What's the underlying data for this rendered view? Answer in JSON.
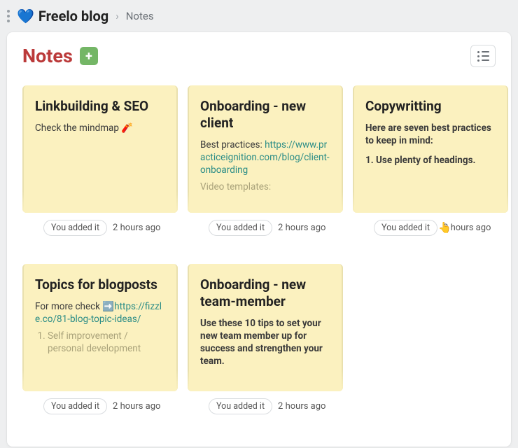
{
  "breadcrumb": {
    "heart": "💙",
    "app": "Freelo blog",
    "current": "Notes"
  },
  "header": {
    "title": "Notes",
    "add_label": "+"
  },
  "meta": {
    "badge": "You added it",
    "time": "2 hours ago"
  },
  "cards": [
    {
      "title": "Linkbuilding & SEO",
      "body_text": "Check the mindmap 🧨"
    },
    {
      "title": "Onboarding - new client",
      "body_label": "Best practices:",
      "body_link": "https://www.practiceignition.com/blog/client-onboarding",
      "faded_label": "Video templates:"
    },
    {
      "title": "Copywritting",
      "body_bold1": "Here are seven best practices to keep in mind:",
      "body_bold2": "1. Use plenty of headings."
    },
    {
      "title": "Topics for blogposts",
      "body_prefix": "For more check ➡️",
      "body_link": "https://fizzle.co/81-blog-topic-ideas/",
      "list1": "Self improvement / personal development"
    },
    {
      "title": "Onboarding - new team-member",
      "body_bold1": "Use these 10 tips to set your new team member up for success and strengthen your team."
    }
  ]
}
